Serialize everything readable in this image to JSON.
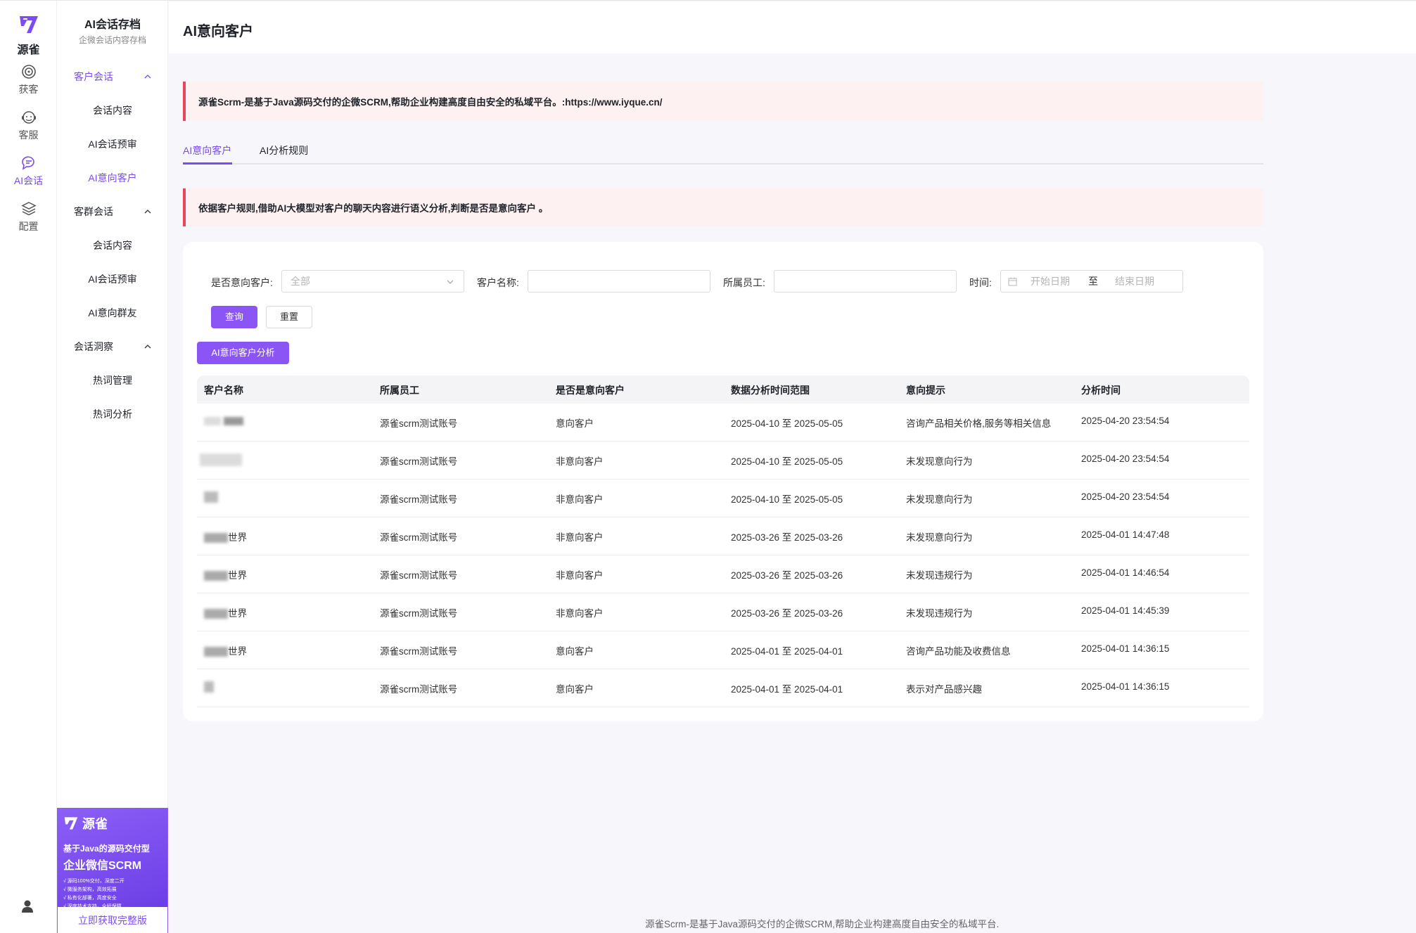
{
  "brand": {
    "logo_text": "源雀",
    "accent": "#7b4dee"
  },
  "rail": [
    {
      "label": "获客",
      "icon": "target-icon"
    },
    {
      "label": "客服",
      "icon": "headset-icon"
    },
    {
      "label": "AI会话",
      "icon": "chat-bubble-icon",
      "active": true
    },
    {
      "label": "配置",
      "icon": "layers-icon"
    }
  ],
  "sub": {
    "title": "AI会话存档",
    "subtitle": "企微会话内容存档",
    "groups": [
      {
        "label": "客户会话",
        "items": [
          "会话内容",
          "AI会话预审",
          "AI意向客户"
        ]
      },
      {
        "label": "客群会话",
        "items": [
          "会话内容",
          "AI会话预审",
          "AI意向群友"
        ]
      },
      {
        "label": "会话洞察",
        "items": [
          "热词管理",
          "热词分析"
        ]
      }
    ]
  },
  "promo": {
    "brand": "源雀",
    "line1": "基于Java的源码交付型",
    "line2": "企业微信SCRM",
    "points": [
      "√ 源码100%交付，深度二开",
      "√ 微服务架构，高效拓展",
      "√ 私有化部署，高度安全",
      "√ 深度技术支持，全程保障"
    ],
    "cta": "立即获取完整版"
  },
  "page": {
    "title": "AI意向客户",
    "notice1": "源雀Scrm-是基于Java源码交付的企微SCRM,帮助企业构建高度自由安全的私域平台。:https://www.iyque.cn/",
    "tabs": [
      "AI意向客户",
      "AI分析规则"
    ],
    "notice2": "依据客户规则,借助AI大模型对客户的聊天内容进行语义分析,判断是否是意向客户 。"
  },
  "filters": {
    "intent_label": "是否意向客户:",
    "intent_value": "全部",
    "name_label": "客户名称:",
    "name_value": "",
    "staff_label": "所属员工:",
    "staff_value": "",
    "time_label": "时间:",
    "start_placeholder": "开始日期",
    "range_sep": "至",
    "end_placeholder": "结束日期",
    "query_btn": "查询",
    "reset_btn": "重置",
    "analyze_btn": "AI意向客户分析"
  },
  "table": {
    "headers": [
      "客户名称",
      "所属员工",
      "是否是意向客户",
      "数据分析时间范围",
      "意向提示",
      "分析时间"
    ],
    "rows": [
      {
        "name": "",
        "staff": "源雀scrm测试账号",
        "intent": "意向客户",
        "range": "2025-04-10 至 2025-05-05",
        "hint": "咨询产品相关价格,服务等相关信息",
        "time": "2025-04-20 23:54:54"
      },
      {
        "name": "",
        "staff": "源雀scrm测试账号",
        "intent": "非意向客户",
        "range": "2025-04-10 至 2025-05-05",
        "hint": "未发现意向行为",
        "time": "2025-04-20 23:54:54"
      },
      {
        "name": "",
        "staff": "源雀scrm测试账号",
        "intent": "非意向客户",
        "range": "2025-04-10 至 2025-05-05",
        "hint": "未发现意向行为",
        "time": "2025-04-20 23:54:54"
      },
      {
        "name": "世界",
        "staff": "源雀scrm测试账号",
        "intent": "非意向客户",
        "range": "2025-03-26 至 2025-03-26",
        "hint": "未发现意向行为",
        "time": "2025-04-01 14:47:48"
      },
      {
        "name": "世界",
        "staff": "源雀scrm测试账号",
        "intent": "非意向客户",
        "range": "2025-03-26 至 2025-03-26",
        "hint": "未发现违规行为",
        "time": "2025-04-01 14:46:54"
      },
      {
        "name": "世界",
        "staff": "源雀scrm测试账号",
        "intent": "非意向客户",
        "range": "2025-03-26 至 2025-03-26",
        "hint": "未发现违规行为",
        "time": "2025-04-01 14:45:39"
      },
      {
        "name": "世界",
        "staff": "源雀scrm测试账号",
        "intent": "意向客户",
        "range": "2025-04-01 至 2025-04-01",
        "hint": "咨询产品功能及收费信息",
        "time": "2025-04-01 14:36:15"
      },
      {
        "name": "",
        "staff": "源雀scrm测试账号",
        "intent": "意向客户",
        "range": "2025-04-01 至 2025-04-01",
        "hint": "表示对产品感兴趣",
        "time": "2025-04-01 14:36:15"
      }
    ]
  },
  "footer": "源雀Scrm-是基于Java源码交付的企微SCRM,帮助企业构建高度自由安全的私域平台."
}
